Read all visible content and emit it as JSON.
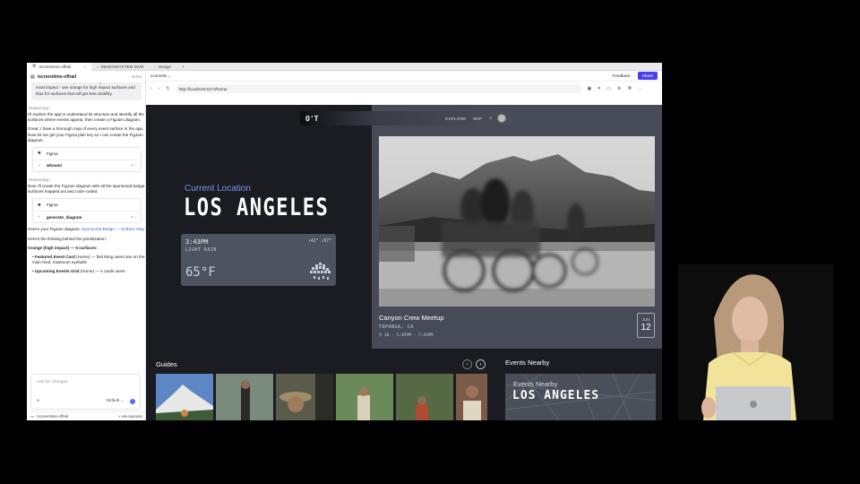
{
  "browser_tabs": [
    {
      "label": "/screentime-offrail",
      "active": true
    },
    {
      "label": "DESIGNSYSTEM DIVR",
      "active": false
    },
    {
      "label": "Design",
      "active": false
    }
  ],
  "left_panel": {
    "title": "/screentime-offrail",
    "sorry": "Sorry",
    "prompt_text": "surfaces where the sponsored badge will have the most impact - use orange for high impact surfaces and blue for surfaces that will get less visibility.",
    "reasoning_label": "Reasoning",
    "para1": "I'll explore the app to understand its structure and identify all the surfaces where events appear, then create a FigJam diagram.",
    "para2": "Great, I have a thorough map of every event surface in the app. Now let me get your Figma plan key so I can create the FigJam diagram.",
    "tool1": {
      "name": "Figma",
      "action": "whoami"
    },
    "para3": "Now I'll create the FigJam diagram with all the sponsored badge surfaces mapped out and color-coded.",
    "tool2": {
      "name": "Figma",
      "action": "generate_diagram"
    },
    "para4_prefix": "Here's your FigJam diagram: ",
    "para4_link": "Sponsored Badge — Surface Map",
    "para5": "Here's the thinking behind the prioritization:",
    "heading_orange": "Orange (high impact) — 5 surfaces:",
    "bullet1_bold": "Featured Event Card",
    "bullet1_rest": " (Home) — first thing users see on the main feed, maximum eyeballs",
    "bullet2_bold": "Upcoming Events Grid",
    "bullet2_rest": " (Home) — 4 cards users",
    "composer_placeholder": "Ask for changes",
    "composer_mode": "Default",
    "footer_repo": "/screentime-offrail",
    "footer_branch": "ele-sponsor"
  },
  "right_panel": {
    "commits_label": "Commits",
    "feedback_label": "Feedback",
    "share_label": "Share",
    "url": "http://localhost:5173/home"
  },
  "app": {
    "logo": "O'T",
    "nav_explore": "EXPLORE",
    "nav_map": "MAP",
    "current_location_label": "Current Location",
    "city": "LOS ANGELES",
    "weather": {
      "time": "3:43PM",
      "condition": "LIGHT RAIN",
      "high_low": "↑42° ↓67°",
      "temp": "65°F"
    },
    "event": {
      "title": "Canyon Crew Meetup",
      "place": "TOPANGA, CA",
      "meta": "⚲ 36 · 5:45PM - 7:45PM",
      "month": "JUN",
      "day": "12"
    },
    "guides_label": "Guides",
    "nearby_label": "Events Nearby",
    "nearby_map_title": "Events Nearby",
    "nearby_map_city": "LOS ANGELES"
  },
  "colors": {
    "accent_blue": "#7a96f0",
    "share_button": "#4a3ee8",
    "app_bg": "#1a1c22"
  }
}
